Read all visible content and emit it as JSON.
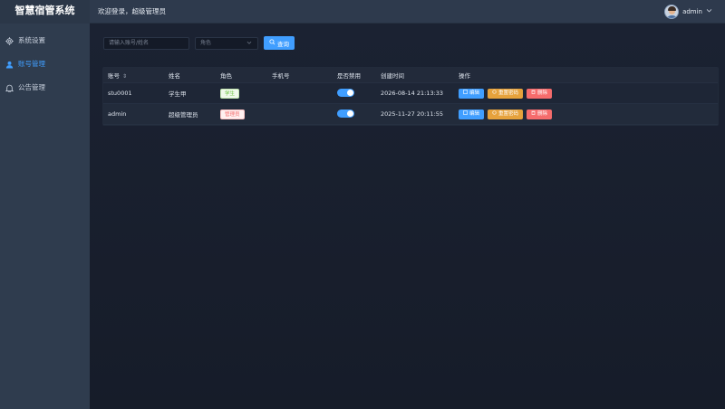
{
  "app": {
    "title": "智慧宿管系统"
  },
  "sidebar": {
    "items": [
      {
        "label": "系统设置",
        "icon": "gear-icon"
      },
      {
        "label": "账号管理",
        "icon": "user-icon"
      },
      {
        "label": "公告管理",
        "icon": "bell-icon"
      }
    ],
    "active_index": 1
  },
  "header": {
    "welcome": "欢迎登录，超级管理员",
    "username": "admin"
  },
  "filters": {
    "search_placeholder": "请输入账号/姓名",
    "role_placeholder": "角色",
    "search_button": "查询"
  },
  "table": {
    "columns": [
      "账号",
      "姓名",
      "角色",
      "手机号",
      "是否禁用",
      "创建时间",
      "操作"
    ],
    "rows": [
      {
        "account": "stu0001",
        "name": "学生甲",
        "role": "学生",
        "phone": "",
        "disabled": false,
        "created": "2026-08-14 21:13:33"
      },
      {
        "account": "admin",
        "name": "超级管理员",
        "role": "管理员",
        "phone": "",
        "disabled": false,
        "created": "2025-11-27 20:11:55"
      }
    ],
    "actions": {
      "edit": "编辑",
      "reset": "重置密码",
      "delete": "删除"
    }
  },
  "colors": {
    "accent": "#409eff",
    "warning": "#e6a23c",
    "danger": "#f56c6c",
    "sidebar_bg": "#2f3c4e",
    "content_bg": "#19202e"
  }
}
